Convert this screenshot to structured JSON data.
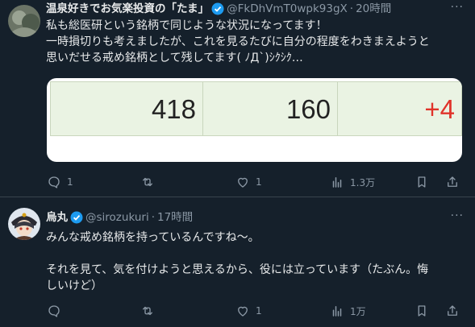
{
  "posts": [
    {
      "name": "温泉好きでお気楽投資の「たま」",
      "handle": "@FkDhVmT0wpk93gX",
      "time": "20時間",
      "text": "私も総医研という銘柄で同じような状況になってます！\n一時損切りも考えましたが、これを見るたびに自分の程度をわきまえようと\n思いだせる戒め銘柄として残してます( ﾉД`)ｼｸｼｸ…",
      "media_cells": [
        "418",
        "160",
        "+4"
      ],
      "stats": {
        "replies": "1",
        "reposts": "",
        "likes": "1",
        "views": "1.3万"
      }
    },
    {
      "name": "烏丸",
      "handle": "@sirozukuri",
      "time": "17時間",
      "text": "みんな戒め銘柄を持っているんですね〜。\n\nそれを見て、気を付けようと思えるから、役には立っています（たぶん。悔\nしいけど）",
      "stats": {
        "replies": "",
        "reposts": "",
        "likes": "1",
        "views": "1万"
      }
    }
  ],
  "separator": "·",
  "more_label": "···",
  "colors": {
    "background": "#15202b",
    "text": "#e7e9ea",
    "muted": "#8b98a5",
    "verified": "#1d9bf0",
    "accent_red": "#e0332b"
  },
  "icons": [
    "verified-badge-icon",
    "reply-icon",
    "repost-icon",
    "like-icon",
    "views-icon",
    "bookmark-icon",
    "share-icon"
  ]
}
